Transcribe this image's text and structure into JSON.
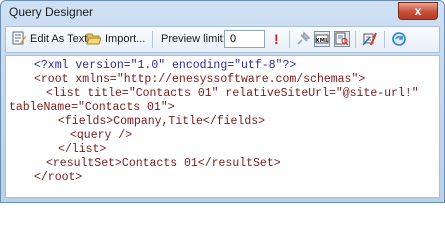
{
  "window": {
    "title": "Query Designer",
    "close_label": "x"
  },
  "toolbar": {
    "edit_as_text": "Edit As Text",
    "import": "Import...",
    "preview_limit_label": "Preview limit:",
    "preview_limit_value": "0",
    "warning_glyph": "!"
  },
  "editor": {
    "lines": [
      "<?xml version=\"1.0\" encoding=\"utf-8\"?>",
      "<root xmlns=\"http://enesyssoftware.com/schemas\">",
      "<list title=\"Contacts 01\" relativeSiteUrl=\"@site-url!\"",
      "tableName=\"Contacts 01\">",
      "<fields>Company,Title</fields>",
      "<query />",
      "</list>",
      "<resultSet>Contacts 01</resultSet>",
      "</root>"
    ]
  }
}
